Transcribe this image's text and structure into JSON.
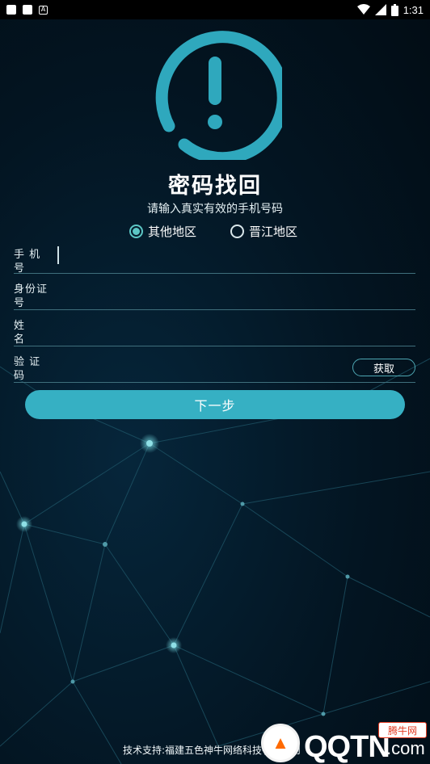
{
  "status_bar": {
    "time": "1:31",
    "left_icons": [
      "notification-square-icon",
      "screenshot-icon",
      "text-a-icon"
    ],
    "right_icons": [
      "wifi-icon",
      "signal-icon",
      "battery-icon"
    ]
  },
  "header": {
    "icon": "alert-exclamation-icon",
    "title": "密码找回",
    "subtitle": "请输入真实有效的手机号码"
  },
  "region": {
    "options": [
      {
        "label": "其他地区",
        "checked": true
      },
      {
        "label": "晋江地区",
        "checked": false
      }
    ]
  },
  "form": {
    "phone": {
      "label": "手 机\n号",
      "value": ""
    },
    "id_number": {
      "label": "身份证\n号",
      "value": ""
    },
    "name": {
      "label": "姓\n名",
      "value": ""
    },
    "code": {
      "label": "验 证\n码",
      "value": "",
      "button_label": "获取"
    }
  },
  "actions": {
    "next_label": "下一步"
  },
  "footer": {
    "text": "技术支持:福建五色神牛网络科技有限公司"
  },
  "watermark": {
    "badge": "腾牛网",
    "brand": "QQTN",
    "suffix": ".com"
  },
  "colors": {
    "accent": "#36b0c3",
    "radio_checked": "#5cc6c4",
    "ring": "#2fa8bd",
    "background": "#031522"
  }
}
